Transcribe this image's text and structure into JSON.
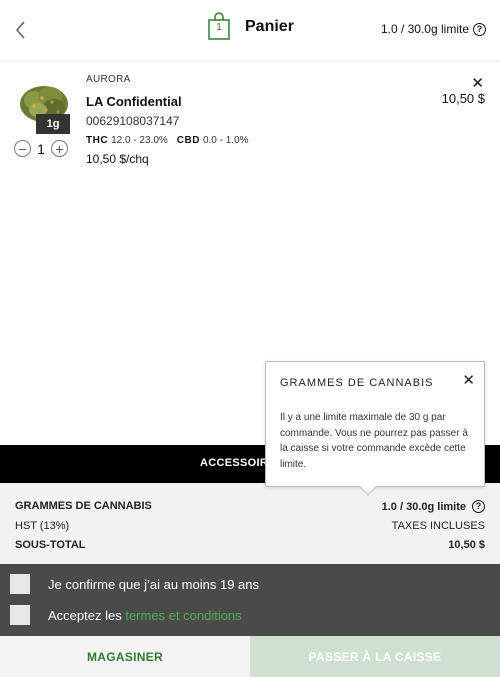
{
  "header": {
    "title": "Panier",
    "bag_count": "1",
    "limit_text": "1.0 / 30.0g limite",
    "info_glyph": "?"
  },
  "item": {
    "brand": "AURORA",
    "name": "LA Confidential",
    "sku": "00629108037147",
    "weight_badge": "1g",
    "thc_label": "THC",
    "thc_value": "12.0 - 23.0%",
    "cbd_label": "CBD",
    "cbd_value": "0.0 - 1.0%",
    "unit_price": "10,50 $/chq",
    "line_total": "10,50 $",
    "quantity": "1",
    "remove_glyph": "✕",
    "minus_glyph": "−",
    "plus_glyph": "+"
  },
  "accessories": {
    "label": "ACCESSOIR"
  },
  "summary": {
    "grams_label": "GRAMMES DE CANNABIS",
    "grams_value": "1.0 / 30.0g limite",
    "tax_label": "HST (13%)",
    "tax_value": "TAXES INCLUSES",
    "subtotal_label": "SOUS-TOTAL",
    "subtotal_value": "10,50 $"
  },
  "confirm": {
    "age_text": "Je confirme que j’ai au moins 19 ans",
    "terms_prefix": "Acceptez les ",
    "terms_link": "termes et conditions"
  },
  "buttons": {
    "shop": "MAGASINER",
    "checkout": "PASSER À LA CAISSE"
  },
  "tooltip": {
    "title": "GRAMMES DE CANNABIS",
    "close_glyph": "✕",
    "text": "Il y a une limite maximale de 30 g par commande. Vous ne pourrez pas passer à la caisse si votre commande excède cette limite."
  },
  "colors": {
    "accent_green": "#2e7d32",
    "link_green": "#4caf50",
    "checkout_disabled": "#cfe0d0",
    "dark_panel": "#4a4a4a"
  }
}
